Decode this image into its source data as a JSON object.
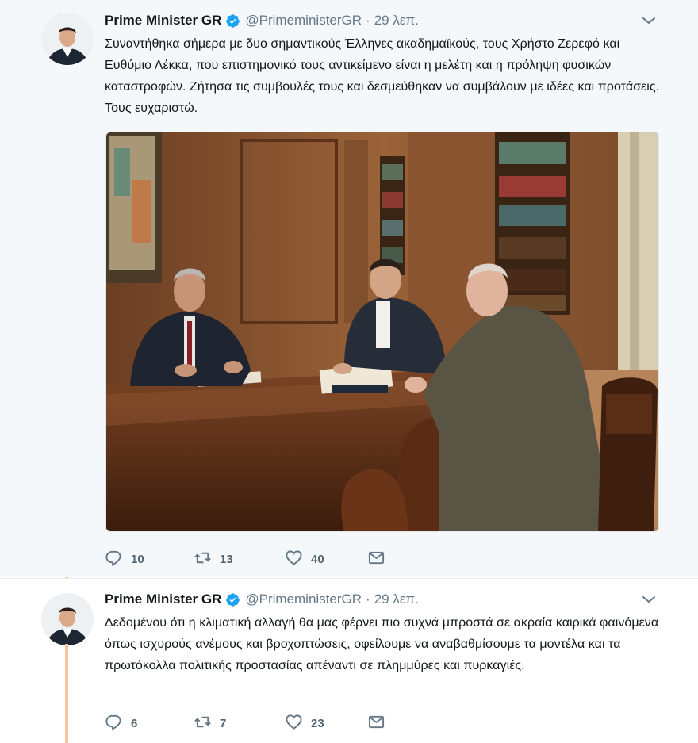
{
  "tweets": [
    {
      "author_name": "Prime Minister GR",
      "handle": "@PrimeministerGR",
      "separator": "·",
      "time": "29 λεπ.",
      "text": "Συναντήθηκα σήμερα με δυο σημαντικούς Έλληνες ακαδημαϊκούς, τους Χρήστο Ζερεφό και Ευθύμιο Λέκκα, που επιστημονικό τους αντικείμενο είναι η μελέτη και η πρόληψη φυσικών καταστροφών. Ζήτησα τις συμβουλές τους και δεσμεύθηκαν να συμβάλουν με ιδέες και προτάσεις. Τους ευχαριστώ.",
      "replies": "10",
      "retweets": "13",
      "likes": "40"
    },
    {
      "author_name": "Prime Minister GR",
      "handle": "@PrimeministerGR",
      "separator": "·",
      "time": "29 λεπ.",
      "text": "Δεδομένου ότι η κλιματική αλλαγή θα μας φέρνει πιο συχνά μπροστά σε ακραία καιρικά φαινόμενα όπως ισχυρούς ανέμους και βροχοπτώσεις, οφείλουμε να αναβαθμίσουμε τα μοντέλα και τα πρωτόκολλα πολιτικής προστασίας απέναντι σε πλημμύρες και πυρκαγιές.",
      "replies": "6",
      "retweets": "7",
      "likes": "23"
    }
  ],
  "icons": {
    "verified": "verified-badge-icon",
    "caret": "chevron-down-icon",
    "reply": "reply-icon",
    "retweet": "retweet-icon",
    "like": "heart-icon",
    "dm": "envelope-icon"
  },
  "colors": {
    "thread_line": "#f5c49b",
    "verified": "#1da1f2",
    "muted": "#657786",
    "selected_bg": "#f5f8fa"
  }
}
